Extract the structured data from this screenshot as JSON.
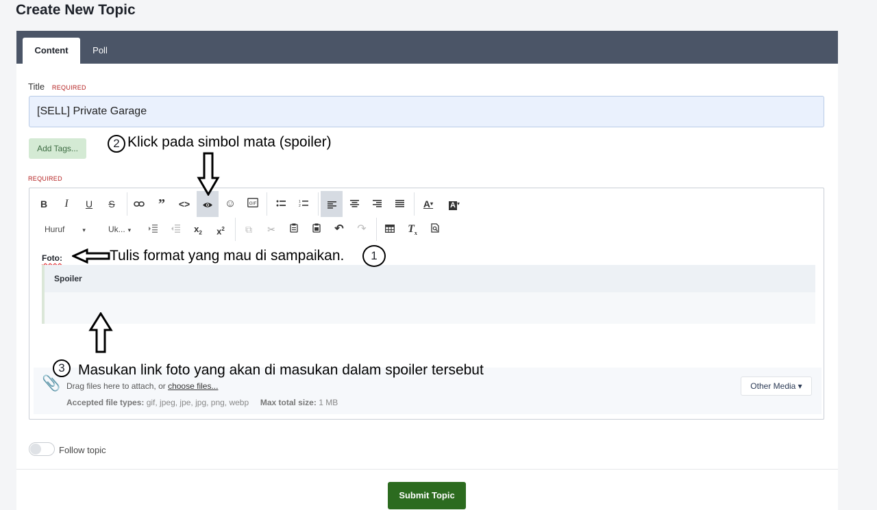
{
  "page": {
    "title": "Create New Topic"
  },
  "tabs": [
    {
      "label": "Content"
    },
    {
      "label": "Poll"
    }
  ],
  "form": {
    "title_label": "Title",
    "required_label": "REQUIRED",
    "title_value": "[SELL] Private Garage",
    "add_tags_label": "Add Tags...",
    "body_required_label": "REQUIRED"
  },
  "toolbar": {
    "font_label": "Huruf",
    "size_label": "Uk...",
    "icons": [
      "bold-icon",
      "italic-icon",
      "underline-icon",
      "strikethrough-icon",
      "link-icon",
      "quote-icon",
      "code-icon",
      "spoiler-eye-icon",
      "emoji-icon",
      "gif-icon",
      "bullet-list-icon",
      "numbered-list-icon",
      "align-left-icon",
      "align-center-icon",
      "align-right-icon",
      "justify-icon",
      "text-color-icon",
      "background-color-icon",
      "indent-icon",
      "outdent-icon",
      "subscript-icon",
      "superscript-icon",
      "copy-icon",
      "cut-icon",
      "paste-icon",
      "paste-text-icon",
      "undo-icon",
      "redo-icon",
      "table-icon",
      "clear-formatting-icon",
      "preview-icon"
    ]
  },
  "editor": {
    "foto_label": "Foto:",
    "spoiler_title": "Spoiler"
  },
  "attachments": {
    "drag_text": "Drag files here to attach, or ",
    "choose_link": "choose files...",
    "accepted_label": "Accepted file types:",
    "accepted_value": "gif, jpeg, jpe, jpg, png, webp",
    "max_label": "Max total size:",
    "max_value": "1 MB",
    "other_media_label": "Other Media ▾"
  },
  "follow": {
    "label": "Follow topic",
    "enabled": false
  },
  "submit": {
    "label": "Submit Topic"
  },
  "annotations": {
    "step1_num": "1",
    "step1_text": "Tulis format yang mau di sampaikan.",
    "step2_num": "2",
    "step2_text": "Klick pada simbol mata (spoiler)",
    "step3_num": "3",
    "step3_text": "Masukan link foto yang akan di masukan dalam spoiler tersebut"
  },
  "colors": {
    "tabbar": "#4b5567",
    "submit": "#2c6b1f",
    "required": "#b42020",
    "title_input_bg": "#eaf1fd"
  }
}
